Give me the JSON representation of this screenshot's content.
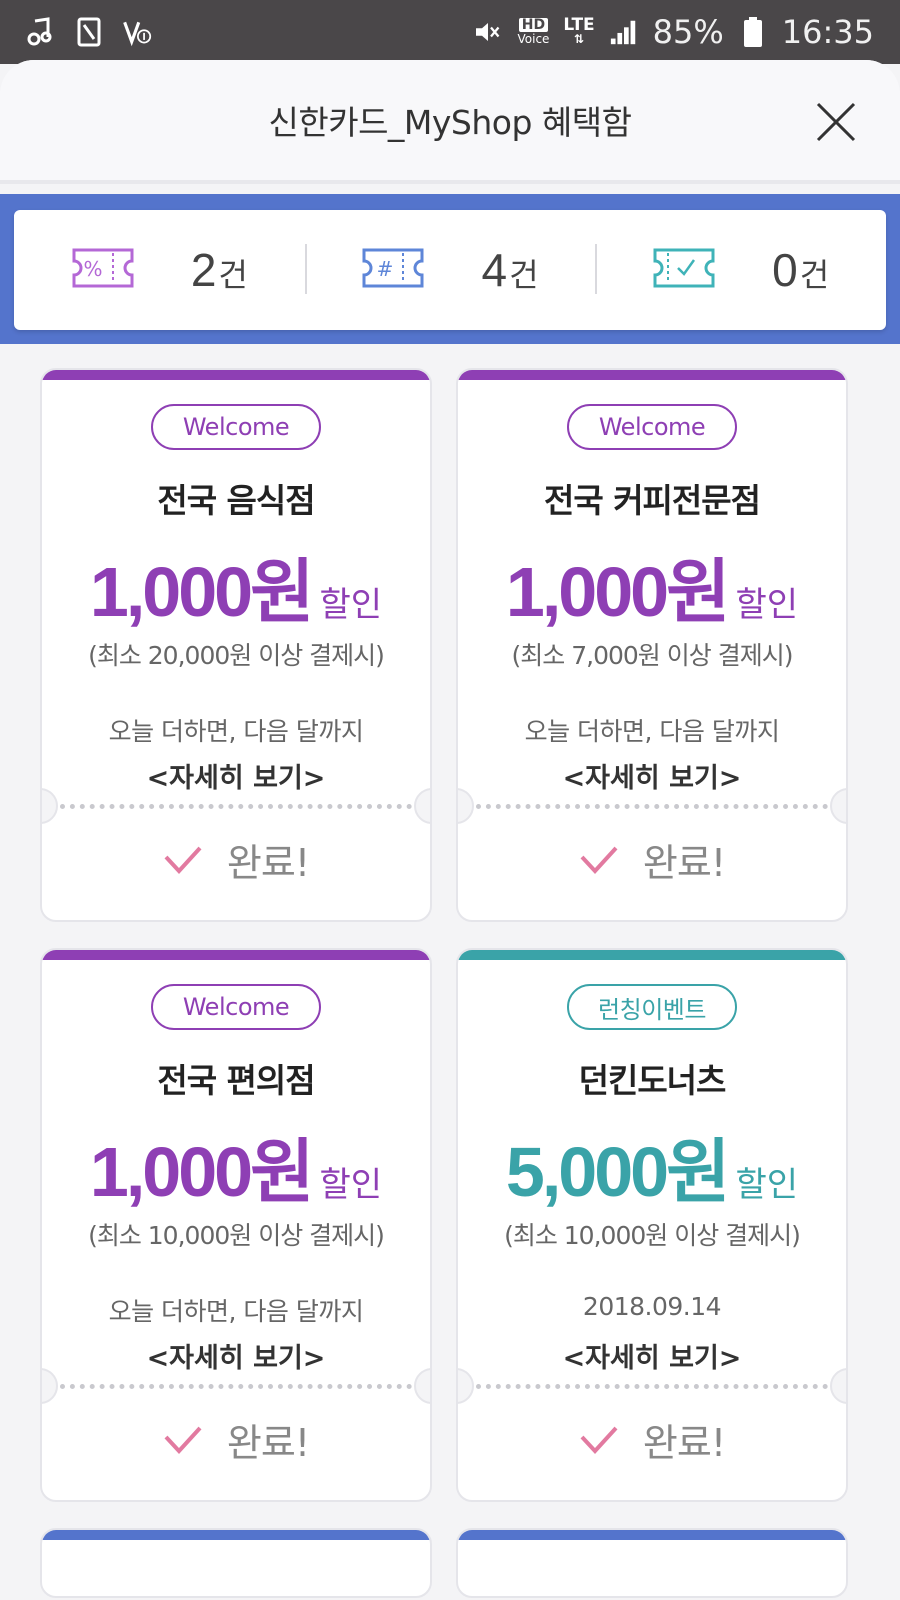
{
  "status_bar": {
    "battery": "85%",
    "time": "16:35",
    "hd_label": "HD",
    "voice_label": "Voice",
    "lte_label": "LTE"
  },
  "header": {
    "title": "신한카드_MyShop 혜택함"
  },
  "summary": [
    {
      "icon": "percent-ticket-icon",
      "count": "2",
      "unit": "건",
      "color": "#b468d6"
    },
    {
      "icon": "hash-ticket-icon",
      "count": "4",
      "unit": "건",
      "color": "#5e86d8"
    },
    {
      "icon": "check-ticket-icon",
      "count": "0",
      "unit": "건",
      "color": "#3fb3b8"
    }
  ],
  "coupons": [
    {
      "tag": "Welcome",
      "store": "전국 음식점",
      "amount": "1,000원",
      "suffix": "할인",
      "condition": "(최소 20,000원 이상 결제시)",
      "period": "오늘 더하면, 다음 달까지",
      "detail": "<자세히 보기>",
      "status": "완료!",
      "color": "#8e3fb4"
    },
    {
      "tag": "Welcome",
      "store": "전국 커피전문점",
      "amount": "1,000원",
      "suffix": "할인",
      "condition": "(최소 7,000원 이상 결제시)",
      "period": "오늘 더하면, 다음 달까지",
      "detail": "<자세히 보기>",
      "status": "완료!",
      "color": "#8e3fb4"
    },
    {
      "tag": "Welcome",
      "store": "전국 편의점",
      "amount": "1,000원",
      "suffix": "할인",
      "condition": "(최소 10,000원 이상 결제시)",
      "period": "오늘 더하면, 다음 달까지",
      "detail": "<자세히 보기>",
      "status": "완료!",
      "color": "#8e3fb4"
    },
    {
      "tag": "런칭이벤트",
      "store": "던킨도너츠",
      "amount": "5,000원",
      "suffix": "할인",
      "condition": "(최소 10,000원 이상 결제시)",
      "period": "2018.09.14",
      "detail": "<자세히 보기>",
      "status": "완료!",
      "color": "#3aa3a8"
    }
  ],
  "colors": {
    "check": "#e27aa0",
    "summary_bg": "#5474cc",
    "next_bar": "#5474cc"
  }
}
